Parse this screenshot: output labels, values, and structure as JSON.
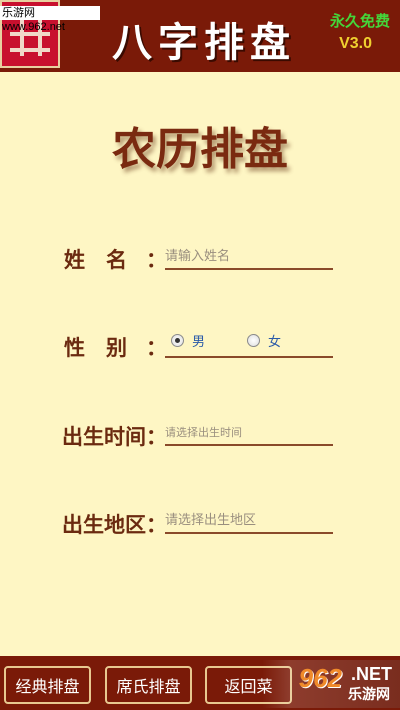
{
  "header": {
    "watermark_top": "乐游网 www.962.net",
    "app_title": "八字排盘",
    "free_label": "永久免费",
    "version": "V3.0",
    "colors": {
      "bar": "#7a1a08",
      "free": "#44d63a",
      "version": "#f0d030"
    }
  },
  "page_title": "农历排盘",
  "form": {
    "name": {
      "label": "姓　名",
      "colon": "：",
      "placeholder": "请输入姓名"
    },
    "gender": {
      "label": "性　别",
      "colon": "：",
      "options": [
        {
          "label": "男",
          "checked": true
        },
        {
          "label": "女",
          "checked": false
        }
      ]
    },
    "birth_time": {
      "label": "出生时间",
      "colon": "：",
      "placeholder": "请选择出生时间"
    },
    "birth_region": {
      "label": "出生地区",
      "colon": "：",
      "placeholder": "请选择出生地区"
    }
  },
  "bottom_bar": {
    "buttons": [
      "经典排盘",
      "席氏排盘",
      "返回菜"
    ]
  },
  "watermark_bottom": {
    "num": "962",
    "net": ".NET",
    "cn": "乐游网"
  }
}
